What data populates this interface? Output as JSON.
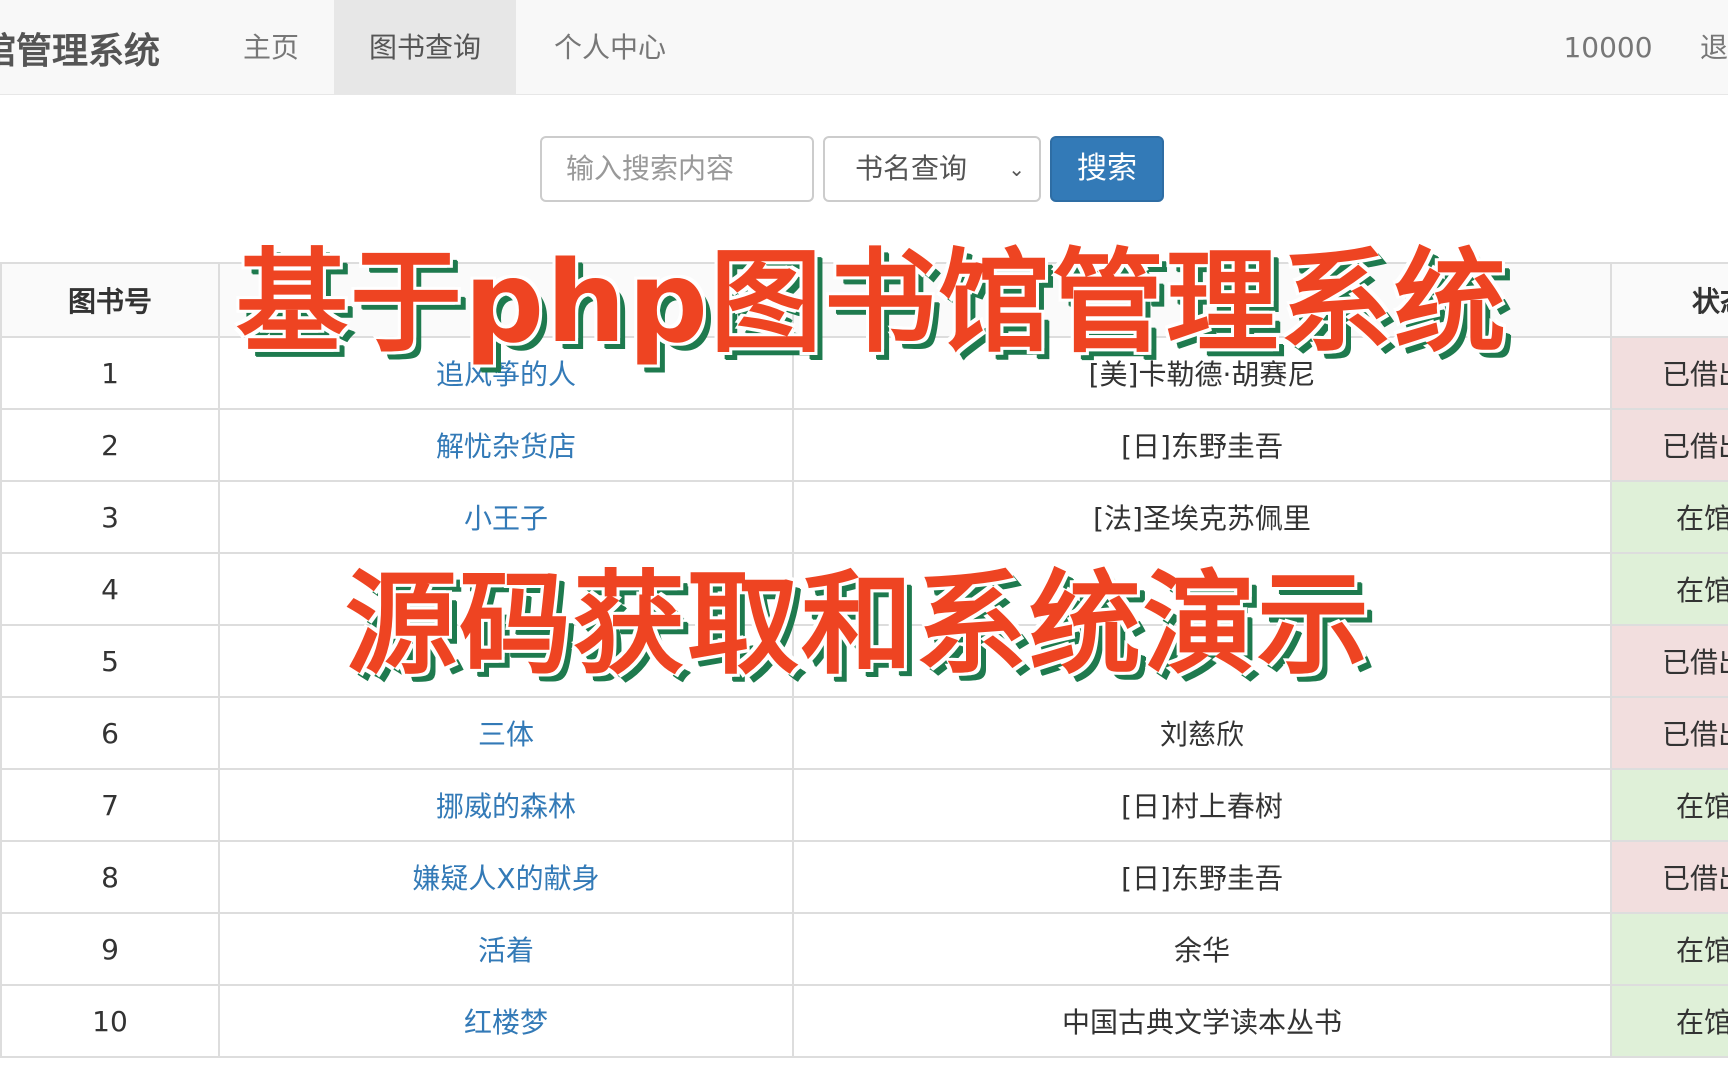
{
  "navbar": {
    "brand": "馆管理系统",
    "items": [
      "主页",
      "图书查询",
      "个人中心"
    ],
    "user": "10000",
    "logout": "退"
  },
  "search": {
    "placeholder": "输入搜索内容",
    "select_value": "书名查询",
    "button": "搜索"
  },
  "table": {
    "headers": [
      "图书号",
      "",
      "",
      "状态"
    ],
    "rows": [
      {
        "id": "1",
        "title": "追风筝的人",
        "author": "[美]卡勒德·胡赛尼",
        "status": "已借出",
        "state": "out"
      },
      {
        "id": "2",
        "title": "解忧杂货店",
        "author": "[日]东野圭吾",
        "status": "已借出",
        "state": "out"
      },
      {
        "id": "3",
        "title": "小王子",
        "author": "[法]圣埃克苏佩里",
        "status": "在馆",
        "state": "in"
      },
      {
        "id": "4",
        "title": "",
        "author": "",
        "status": "在馆",
        "state": "in"
      },
      {
        "id": "5",
        "title": "",
        "author": "",
        "status": "已借出",
        "state": "out"
      },
      {
        "id": "6",
        "title": "三体",
        "author": "刘慈欣",
        "status": "已借出",
        "state": "out"
      },
      {
        "id": "7",
        "title": "挪威的森林",
        "author": "[日]村上春树",
        "status": "在馆",
        "state": "in"
      },
      {
        "id": "8",
        "title": "嫌疑人X的献身",
        "author": "[日]东野圭吾",
        "status": "已借出",
        "state": "out"
      },
      {
        "id": "9",
        "title": "活着",
        "author": "余华",
        "status": "在馆",
        "state": "in"
      },
      {
        "id": "10",
        "title": "红楼梦",
        "author": "中国古典文学读本丛书",
        "status": "在馆",
        "state": "in"
      }
    ]
  },
  "overlay": {
    "line1": "基于php图书馆管理系统",
    "line2": "源码获取和系统演示"
  }
}
